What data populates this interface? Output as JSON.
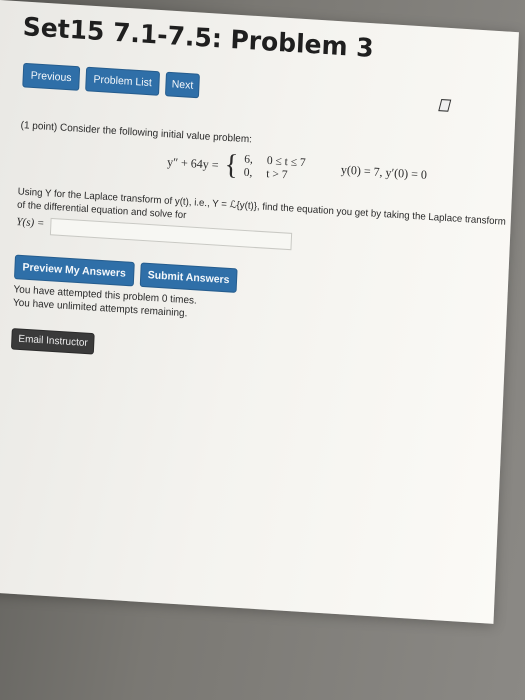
{
  "page": {
    "title": "Set15 7.1-7.5: Problem 3"
  },
  "nav": {
    "previous": "Previous",
    "problem_list": "Problem List",
    "next": "Next"
  },
  "problem": {
    "intro": "(1 point) Consider the following initial value problem:",
    "equation_lhs": "y″ + 64y =",
    "case1_value": "6,",
    "case1_cond": "0 ≤ t ≤ 7",
    "case2_value": "0,",
    "case2_cond": "t > 7",
    "initial_conditions": "y(0) = 7,  y′(0) = 0",
    "instructions": "Using Y for the Laplace transform of y(t), i.e., Y = ℒ{y(t)}, find the equation you get by taking the Laplace transform of the differential equation and solve for",
    "answer_label": "Y(s) =",
    "answer_value": ""
  },
  "actions": {
    "preview": "Preview My Answers",
    "submit": "Submit Answers",
    "email": "Email Instructor"
  },
  "status": {
    "attempts": "You have attempted this problem 0 times.",
    "remaining": "You have unlimited attempts remaining."
  },
  "colors": {
    "button_blue": "#2f6fa8",
    "email_button": "#3a3a3a"
  }
}
